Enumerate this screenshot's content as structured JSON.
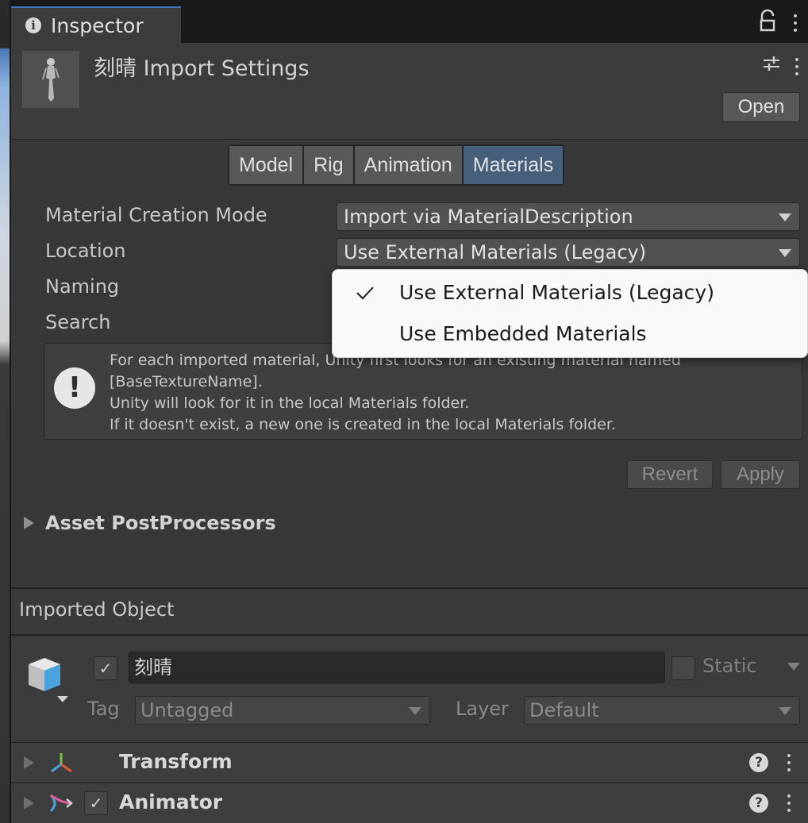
{
  "tab": {
    "label": "Inspector"
  },
  "header": {
    "title": "刻晴 Import Settings",
    "open_label": "Open"
  },
  "mode_tabs": [
    {
      "label": "Model",
      "active": false
    },
    {
      "label": "Rig",
      "active": false
    },
    {
      "label": "Animation",
      "active": false
    },
    {
      "label": "Materials",
      "active": true
    }
  ],
  "fields": {
    "creation_mode_label": "Material Creation Mode",
    "creation_mode_value": "Import via MaterialDescription",
    "location_label": "Location",
    "location_value": "Use External Materials (Legacy)",
    "naming_label": "Naming",
    "search_label": "Search"
  },
  "help": {
    "text": "For each imported material, Unity first looks for an existing material named\n[BaseTextureName].\nUnity will look for it in the local Materials folder.\nIf it doesn't exist, a new one is created in the local Materials folder."
  },
  "buttons": {
    "revert": "Revert",
    "apply": "Apply"
  },
  "postprocessors": {
    "label": "Asset PostProcessors"
  },
  "imported_object": {
    "section_title": "Imported Object",
    "name": "刻晴",
    "static_label": "Static",
    "tag_label": "Tag",
    "tag_value": "Untagged",
    "layer_label": "Layer",
    "layer_value": "Default"
  },
  "components": [
    {
      "name": "Transform"
    },
    {
      "name": "Animator"
    }
  ],
  "popup": {
    "items": [
      {
        "label": "Use External Materials (Legacy)",
        "checked": true
      },
      {
        "label": "Use Embedded Materials",
        "checked": false
      }
    ]
  },
  "colors": {
    "accent": "#3a79bb",
    "active_tab": "#46607c",
    "panel": "#383838"
  }
}
